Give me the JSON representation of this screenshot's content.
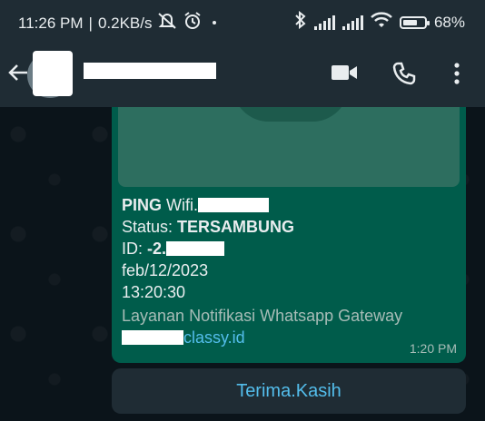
{
  "status_bar": {
    "time": "11:26 PM",
    "speed": "0.2KB/s",
    "battery": "68%",
    "battery_level": 0.68,
    "icons": [
      "mute-icon",
      "alarm-icon",
      "dot-icon",
      "bluetooth-icon",
      "signal-icon",
      "signal-icon",
      "wifi-icon",
      "battery-icon"
    ]
  },
  "header": {
    "contact_name": "",
    "icons": [
      "back-arrow-icon",
      "video-call-icon",
      "voice-call-icon",
      "more-options-icon"
    ]
  },
  "message": {
    "line1_bold": "PING",
    "line1_rest": " Wifi.",
    "line2_label": "Status: ",
    "line2_value": "TERSAMBUNG",
    "line3_label": "ID: ",
    "line3_value": "-2.",
    "line4": "feb/12/2023",
    "line5": "13:20:30",
    "footer": "Layanan Notifikasi Whatsapp Gateway",
    "link": "classy.id",
    "time": "1:20 PM"
  },
  "reply_button": {
    "label": "Terima.Kasih"
  },
  "colors": {
    "bubble": "#005c4b",
    "header": "#1f2c34",
    "link": "#53bdeb",
    "background": "#0b141a"
  }
}
